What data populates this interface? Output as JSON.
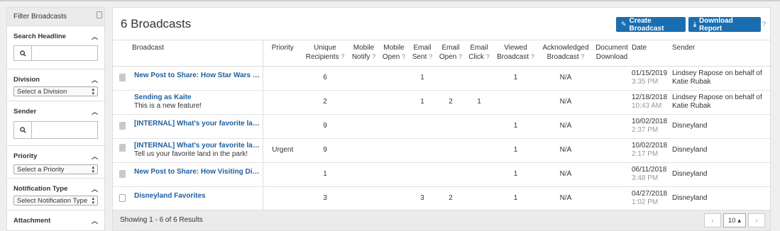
{
  "sidebar": {
    "title": "Filter Broadcasts",
    "search_headline": {
      "label": "Search Headline",
      "value": ""
    },
    "division": {
      "label": "Division",
      "selected": "Select a Division"
    },
    "sender": {
      "label": "Sender",
      "value": ""
    },
    "priority": {
      "label": "Priority",
      "selected": "Select a Priority"
    },
    "notification_type": {
      "label": "Notification Type",
      "selected": "Select Notification Type"
    },
    "attachment": {
      "label": "Attachment"
    }
  },
  "main": {
    "title": "6 Broadcasts",
    "create_button": "Create Broadcast",
    "download_button": "Download Report",
    "help": "?"
  },
  "columns": {
    "broadcast": "Broadcast",
    "priority": "Priority",
    "unique_recipients": [
      "Unique",
      "Recipients"
    ],
    "mobile_notify": [
      "Mobile",
      "Notify"
    ],
    "mobile_open": [
      "Mobile",
      "Open"
    ],
    "email_sent": [
      "Email",
      "Sent"
    ],
    "email_open": [
      "Email",
      "Open"
    ],
    "email_click": [
      "Email",
      "Click"
    ],
    "viewed_broadcast": [
      "Viewed",
      "Broadcast"
    ],
    "acknowledged_broadcast": [
      "Acknowledged",
      "Broadcast"
    ],
    "document_download": [
      "Document",
      "Download"
    ],
    "date": "Date",
    "sender": "Sender",
    "q": "?"
  },
  "rows": [
    {
      "icon": "post-icon",
      "title": "New Post to Share: How Star Wars Lan...",
      "subtitle": "",
      "priority": "",
      "unique": "6",
      "mobile_notify": "",
      "mobile_open": "",
      "email_sent": "1",
      "email_open": "",
      "email_click": "",
      "viewed": "1",
      "ack": "N/A",
      "doc": "",
      "date": "01/15/2019",
      "time": "3:35 PM",
      "sender": "Lindsey Rapose on behalf of Katie Rubak"
    },
    {
      "icon": "",
      "title": "Sending as Kaite",
      "subtitle": "This is a new feature!",
      "priority": "",
      "unique": "2",
      "mobile_notify": "",
      "mobile_open": "",
      "email_sent": "1",
      "email_open": "2",
      "email_click": "1",
      "viewed": "",
      "ack": "N/A",
      "doc": "",
      "date": "12/18/2018",
      "time": "10:43 AM",
      "sender": "Lindsey Rapose on behalf of Katie Rubak"
    },
    {
      "icon": "post-icon",
      "title": "[INTERNAL] What's your favorite land?",
      "subtitle": "",
      "priority": "",
      "unique": "9",
      "mobile_notify": "",
      "mobile_open": "",
      "email_sent": "",
      "email_open": "",
      "email_click": "",
      "viewed": "1",
      "ack": "N/A",
      "doc": "",
      "date": "10/02/2018",
      "time": "2:37 PM",
      "sender": "Disneyland"
    },
    {
      "icon": "post-icon",
      "title": "[INTERNAL] What's your favorite land?",
      "subtitle": "Tell us your favorite land in the park!",
      "priority": "Urgent",
      "unique": "9",
      "mobile_notify": "",
      "mobile_open": "",
      "email_sent": "",
      "email_open": "",
      "email_click": "",
      "viewed": "1",
      "ack": "N/A",
      "doc": "",
      "date": "10/02/2018",
      "time": "2:17 PM",
      "sender": "Disneyland"
    },
    {
      "icon": "post-icon",
      "title": "New Post to Share: How Visiting Disne...",
      "subtitle": "",
      "priority": "",
      "unique": "1",
      "mobile_notify": "",
      "mobile_open": "",
      "email_sent": "",
      "email_open": "",
      "email_click": "",
      "viewed": "1",
      "ack": "N/A",
      "doc": "",
      "date": "06/11/2018",
      "time": "3:48 PM",
      "sender": "Disneyland"
    },
    {
      "icon": "document-icon",
      "title": "Disneyland Favorites",
      "subtitle": "",
      "priority": "",
      "unique": "3",
      "mobile_notify": "",
      "mobile_open": "",
      "email_sent": "3",
      "email_open": "2",
      "email_click": "",
      "viewed": "1",
      "ack": "N/A",
      "doc": "",
      "date": "04/27/2018",
      "time": "1:02 PM",
      "sender": "Disneyland"
    }
  ],
  "footer": {
    "results": "Showing 1 - 6 of 6 Results",
    "prev": "‹",
    "page_size": "10 ▴",
    "next": "›"
  }
}
